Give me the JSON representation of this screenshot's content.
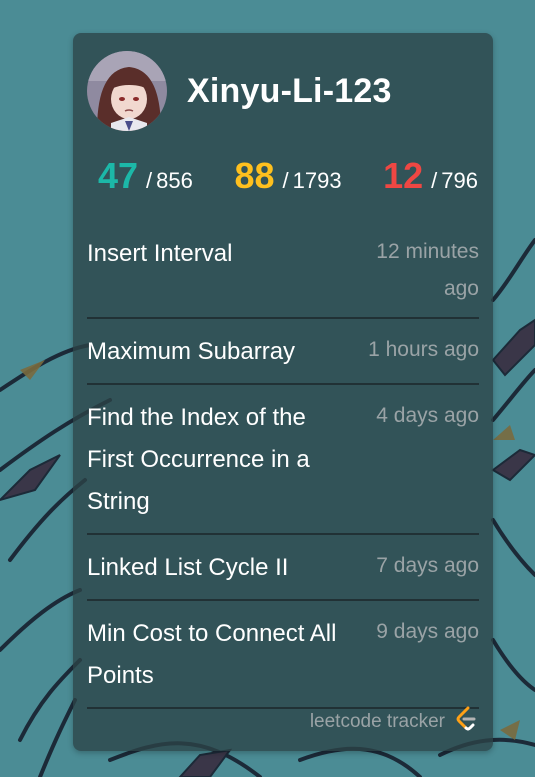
{
  "user": {
    "name": "Xinyu-Li-123",
    "avatar_icon": "anime-avatar-icon"
  },
  "stats": {
    "easy": {
      "solved": "47",
      "total": "856",
      "color": "#1cb8a8"
    },
    "medium": {
      "solved": "88",
      "total": "1793",
      "color": "#ffc01e"
    },
    "hard": {
      "solved": "12",
      "total": "796",
      "color": "#ef4743"
    },
    "separator": "/"
  },
  "submissions": [
    {
      "title": "Insert Interval",
      "time": "12 minutes ago"
    },
    {
      "title": "Maximum Subarray",
      "time": "1 hours ago"
    },
    {
      "title": "Find the Index of the First Occurrence in a String",
      "time": "4 days ago"
    },
    {
      "title": "Linked List Cycle II",
      "time": "7 days ago"
    },
    {
      "title": "Min Cost to Connect All Points",
      "time": "9 days ago"
    }
  ],
  "footer": {
    "label": "leetcode tracker",
    "logo_icon": "leetcode-logo-icon"
  },
  "colors": {
    "background": "#4b8c95",
    "card": "#2c4347",
    "text": "#ffffff",
    "muted": "#9aa3a6"
  }
}
